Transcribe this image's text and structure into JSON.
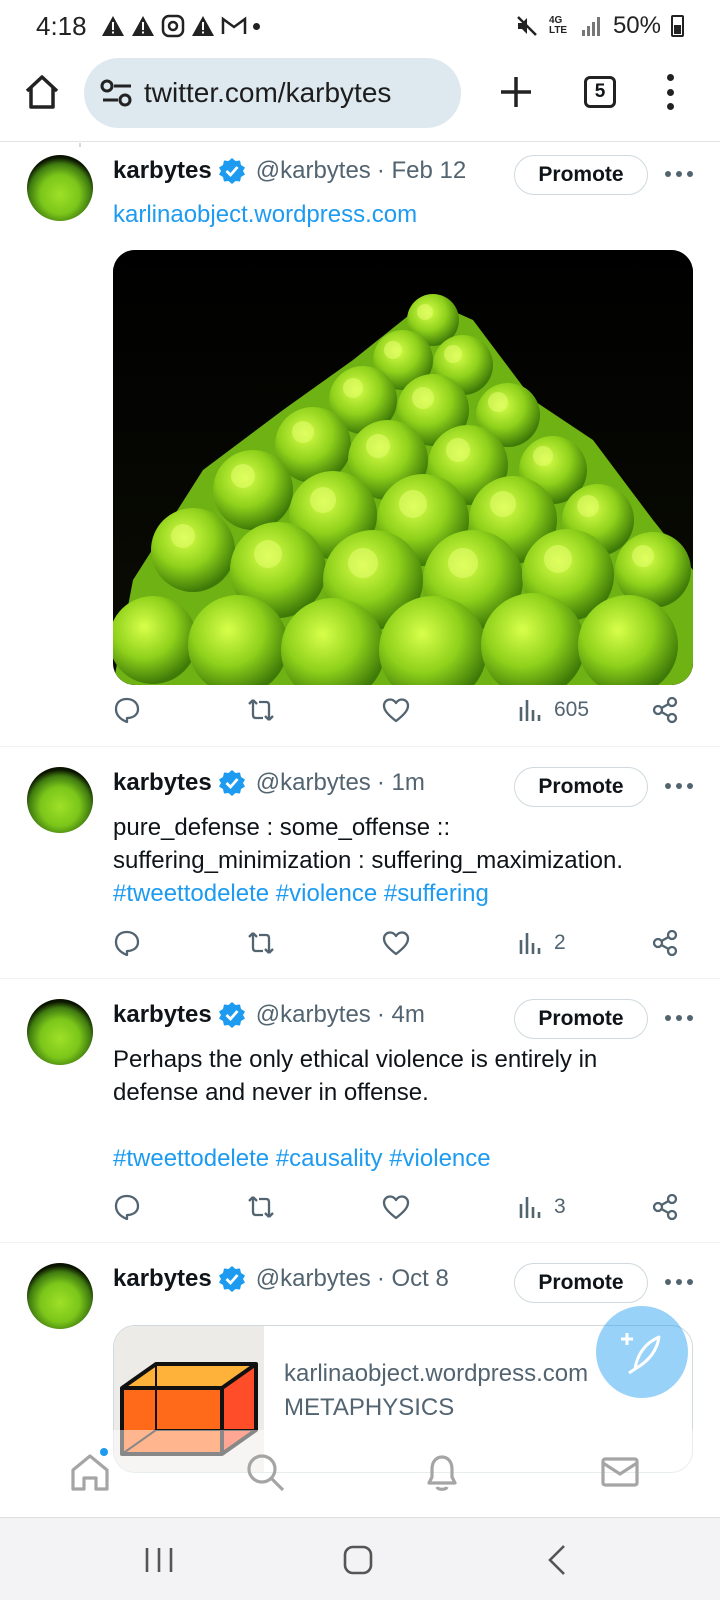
{
  "status_bar": {
    "time": "4:18",
    "battery": "50%",
    "network": "4G LTE"
  },
  "browser": {
    "url": "twitter.com/karbytes",
    "tab_count": "5"
  },
  "tweets": [
    {
      "name": "karbytes",
      "handle": "@karbytes",
      "time": "· Feb 12",
      "promote_label": "Promote",
      "link": "karlinaobject.wordpress.com",
      "views": "605"
    },
    {
      "name": "karbytes",
      "handle": "@karbytes",
      "time": "· 1m",
      "promote_label": "Promote",
      "text_lines": [
        "pure_defense : some_offense ::",
        "suffering_minimization : suffering_maximization."
      ],
      "hashtags": [
        "#tweettodelete",
        "#violence",
        "#suffering"
      ],
      "views": "2"
    },
    {
      "name": "karbytes",
      "handle": "@karbytes",
      "time": "· 4m",
      "promote_label": "Promote",
      "text_lines": [
        "Perhaps the only ethical violence is entirely in",
        "defense and never in offense."
      ],
      "hashtags": [
        "#tweettodelete",
        "#causality",
        "#violence"
      ],
      "views": "3"
    },
    {
      "name": "karbytes",
      "handle": "@karbytes",
      "time": "· Oct 8",
      "promote_label": "Promote",
      "card": {
        "domain": "karlinaobject.wordpress.com",
        "title": "METAPHYSICS"
      }
    }
  ],
  "colors": {
    "accent": "#1d9bf0",
    "muted_text": "#536471",
    "url_pill": "#dde8ef"
  },
  "icons": {
    "reply": "speech-bubble",
    "retweet": "retweet-arrows",
    "like": "heart",
    "views": "bar-chart",
    "share": "share-nodes",
    "compose": "feather-plus"
  }
}
